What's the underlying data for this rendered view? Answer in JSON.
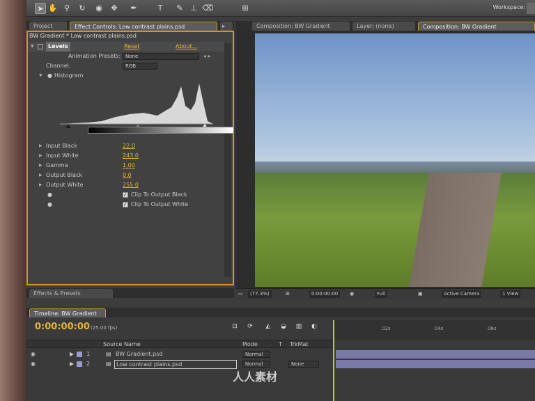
{
  "toolbar": {
    "workspace_label": "Workspace:",
    "tools": [
      "selection-tool",
      "hand-tool",
      "zoom-tool",
      "rotate-tool",
      "camera-tool",
      "pan-behind-tool",
      "pen-tool",
      "text-tool",
      "brush-tool",
      "clone-stamp-tool",
      "eraser-tool"
    ]
  },
  "project_tab": "Project",
  "effect_controls": {
    "tab": "Effect Controls: Low contrast plains.psd",
    "header": "BW Gradient * Low contrast plains.psd",
    "effect_name": "Levels",
    "reset": "Reset",
    "about": "About...",
    "presets_label": "Animation Presets:",
    "presets_value": "None",
    "channel_label": "Channel:",
    "channel_value": "RGB",
    "histogram_label": "Histogram",
    "params": [
      {
        "label": "Input Black",
        "value": "22.0"
      },
      {
        "label": "Input White",
        "value": "243.0"
      },
      {
        "label": "Gamma",
        "value": "1.00"
      },
      {
        "label": "Output Black",
        "value": "0.0"
      },
      {
        "label": "Output White",
        "value": "255.0"
      }
    ],
    "clip_black": "Clip To Output Black",
    "clip_white": "Clip To Output White"
  },
  "effects_presets_tab": "Effects & Presets",
  "composition": {
    "tab1": "Composition: BW Gradient",
    "tab2": "Layer: (none)",
    "tab3": "Composition: BW Gradient",
    "zoom": "(77.3%)",
    "timecode": "0:00:00:00",
    "resolution": "Full",
    "camera": "Active Camera",
    "views": "1 View"
  },
  "timeline": {
    "tab": "Timeline: BW Gradient",
    "time": "0:00:00:00",
    "fps": "(25.00 fps)",
    "col_source": "Source Name",
    "col_mode": "Mode",
    "col_t": "T",
    "col_trkmat": "TrkMat",
    "ruler": [
      "02s",
      "04s",
      "06s"
    ],
    "layers": [
      {
        "num": "1",
        "name": "BW Gradient.psd",
        "mode": "Normal",
        "trkmat": ""
      },
      {
        "num": "2",
        "name": "Low contrast plains.psd",
        "mode": "Normal",
        "trkmat": "None"
      }
    ]
  },
  "watermark": "人人素材"
}
